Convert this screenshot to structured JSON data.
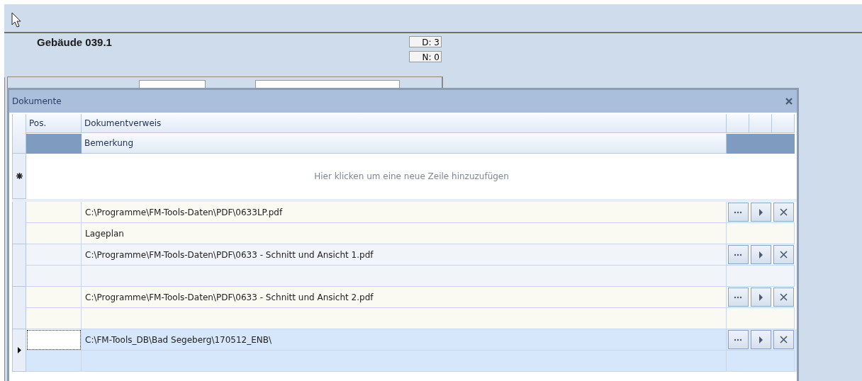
{
  "header": {
    "title": "Gebäude 039.1",
    "counters": [
      "D: 3",
      "N: 0"
    ]
  },
  "dialog": {
    "title": "Dokumente",
    "columns": [
      "Pos.",
      "Dokumentverweis"
    ],
    "subcolumn": "Bemerkung",
    "new_row": {
      "text": "Hier klicken um eine neue Zeile hinzuzufügen"
    },
    "rows": [
      {
        "document": "C:\\Programme\\FM-Tools-Daten\\PDF\\0633LP.pdf",
        "remark": "Lageplan",
        "selected": false
      },
      {
        "document": "C:\\Programme\\FM-Tools-Daten\\PDF\\0633 - Schnitt und Ansicht 1.pdf",
        "selected": false
      },
      {
        "document": "C:\\Programme\\FM-Tools-Daten\\PDF\\0633 - Schnitt und Ansicht 2.pdf",
        "selected": false
      },
      {
        "document": "C:\\FM-Tools_DB\\Bad Segeberg\\170512_ENB\\",
        "selected": true
      }
    ]
  }
}
